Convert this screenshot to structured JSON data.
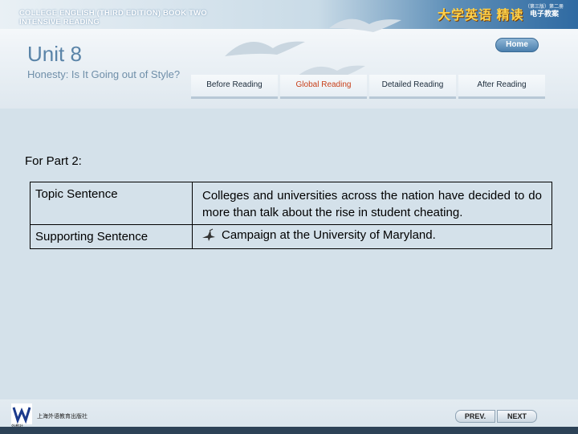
{
  "header": {
    "course_line1": "COLLEGE ENGLISH (THIRD EDITION) BOOK TWO",
    "course_line2": "INTENSIVE READING",
    "brand": "大学英语 精读",
    "brand_small": "（第三版）第二册",
    "brand_sub": "电子教案"
  },
  "unit": {
    "title": "Unit 8",
    "subtitle": "Honesty: Is It Going out of Style?"
  },
  "home_label": "Home",
  "tabs": [
    {
      "label": "Before Reading"
    },
    {
      "label": "Global Reading"
    },
    {
      "label": "Detailed Reading"
    },
    {
      "label": "After Reading"
    }
  ],
  "content": {
    "heading": "For Part 2:",
    "rows": [
      {
        "label": "Topic Sentence",
        "value": "Colleges and universities across the nation have decided to do more than talk about the rise in student cheating."
      },
      {
        "label": "Supporting Sentence",
        "value": "Campaign at the University of Maryland."
      }
    ]
  },
  "footer": {
    "logo_caption": "外教社",
    "publisher": "上海外语教育出版社",
    "prev_label": "PREV.",
    "next_label": "NEXT"
  },
  "colors": {
    "accent_red": "#d0381a",
    "title_blue": "#5a84a8",
    "background": "#d4e1ea"
  }
}
